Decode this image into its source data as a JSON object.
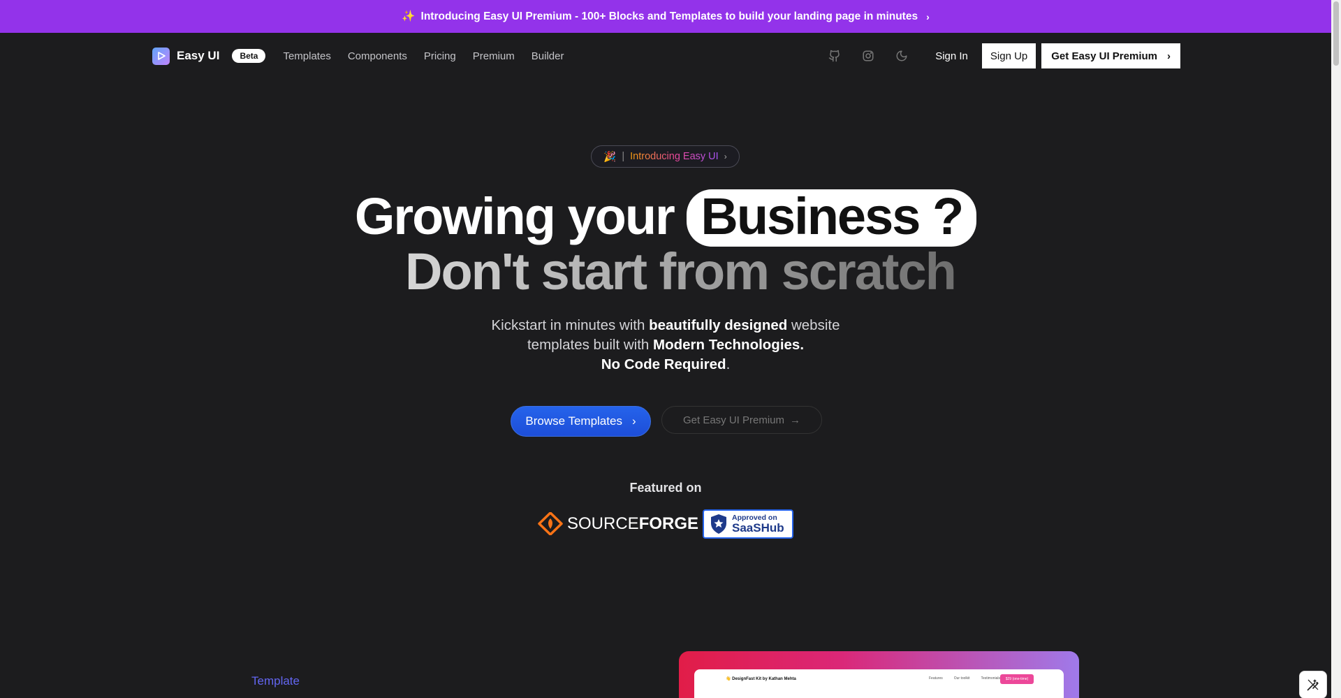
{
  "banner": {
    "emoji": "✨",
    "text": "Introducing Easy UI Premium - 100+ Blocks and Templates to build your landing page in minutes",
    "chevron": "›"
  },
  "nav": {
    "brand": "Easy UI",
    "badge": "Beta",
    "links": [
      "Templates",
      "Components",
      "Pricing",
      "Premium",
      "Builder"
    ],
    "sign_in": "Sign In",
    "sign_up": "Sign Up",
    "premium_cta": "Get Easy UI Premium",
    "premium_chevron": "›"
  },
  "hero": {
    "pill_emoji": "🎉",
    "pill_sep": "|",
    "pill_text": "Introducing Easy UI",
    "pill_chevron": "›",
    "title_line1_pre": "Growing your",
    "title_line1_highlight": "Business ?",
    "title_line2": "Don't start from scratch",
    "sub_1": "Kickstart in minutes with ",
    "sub_1_bold": "beautifully designed",
    "sub_1_post": " website",
    "sub_2": "templates built with ",
    "sub_2_bold": "Modern Technologies.",
    "sub_3_bold": "No Code Required",
    "sub_3_post": ".",
    "browse_label": "Browse Templates",
    "browse_chevron": "›",
    "get_premium_label": "Get Easy UI Premium",
    "get_premium_arrow": "→"
  },
  "featured": {
    "heading": "Featured on",
    "sourceforge_light": "SOURCE",
    "sourceforge_bold": "FORGE",
    "saashub_line1": "Approved on",
    "saashub_line2": "SaaSHub"
  },
  "section": {
    "label": "Template",
    "preview_brand": "👋 DesignFast Kit by Kathan Mehta",
    "preview_links": [
      "Features",
      "Our toolkit",
      "Testimonials"
    ],
    "preview_button": "$29 (one-time)"
  },
  "colors": {
    "banner": "#9333ea",
    "background": "#1c1c1e",
    "primary_button": "#2563eb",
    "accent": "#6366f1"
  }
}
